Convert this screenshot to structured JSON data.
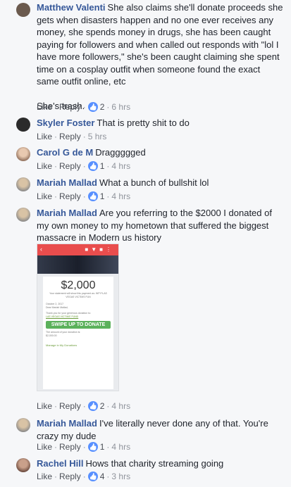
{
  "colors": {
    "name": "#365899",
    "meta": "#90949c",
    "like_blue": "#5890ff",
    "swipe_green": "#5bb15b",
    "phone_red": "#e94d4d"
  },
  "actions": {
    "like": "Like",
    "reply": "Reply",
    "separator": "·"
  },
  "comments": [
    {
      "author": "Matthew Valenti",
      "text": "She also claims she'll donate proceeds she gets when disasters happen and no one ever receives any money, she spends money in drugs, she has been caught paying for followers and when called out responds with \"lol I have more followers,\" she's been caught claiming she spent time on a cosplay outfit when someone found the exact same outfit online, etc\n\nShe's trash.",
      "likes": "2",
      "time": "6 hrs"
    },
    {
      "author": "Skyler Foster",
      "text": "That is pretty shit to do",
      "likes": "",
      "time": "5 hrs"
    },
    {
      "author": "Carol G de M",
      "text": "Draggggged",
      "likes": "1",
      "time": "4 hrs"
    },
    {
      "author": "Mariah Mallad",
      "text": "What a bunch of bullshit lol",
      "likes": "1",
      "time": "4 hrs"
    },
    {
      "author": "Mariah Mallad",
      "text": "Are you referring to the $2000 I donated of my own money to my hometown that suffered the biggest massacre in Modern us history",
      "likes": "2",
      "time": "4 hrs",
      "attachment": {
        "amount": "$2,000",
        "subtitle": "Your statement will show this payment as: WPY*LAS VEGAS VICTIMS FUN",
        "date": "October 2, 2017",
        "greeting": "Dear Mariah Mallad,",
        "thanks": "Thank you for your generous donation to:",
        "fund": "LAS VEGAS VICTIMS' FUND",
        "swipe": "SWIPE UP TO DONATE",
        "amount_note": "The amount of your donation is:",
        "amount_value": "$2,000.00",
        "manage": "Manage in My Donations"
      }
    },
    {
      "author": "Mariah Mallad",
      "text": "I've literally never done any of that. You're crazy my dude",
      "likes": "1",
      "time": "4 hrs"
    },
    {
      "author": "Rachel Hill",
      "text": "Hows that charity streaming going",
      "likes": "4",
      "time": "3 hrs"
    }
  ]
}
